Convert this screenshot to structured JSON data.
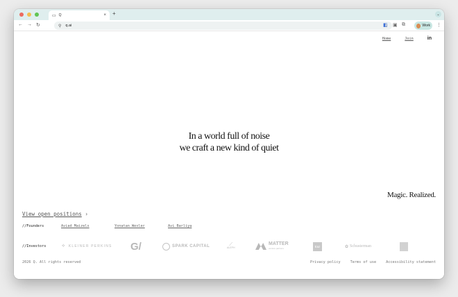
{
  "browser": {
    "tab_title": "Q",
    "url": "q.ai",
    "profile_label": "Work",
    "colors": {
      "tabbar": "#dfeeee",
      "light_red": "#ec6a5e",
      "light_yellow": "#f4bf4f",
      "light_green": "#61c554"
    }
  },
  "nav": {
    "home": "Home",
    "join": "Join",
    "linkedin": "in"
  },
  "hero": {
    "line1": "In a world full of noise",
    "line2": "we craft a new kind of quiet"
  },
  "tagline": "Magic. Realized.",
  "positions": {
    "label": "View open positions",
    "arrow": "›"
  },
  "founders": {
    "label": "//Founders",
    "names": [
      "Aviad Maizels",
      "Yonatan Wexler",
      "Avi Barliya"
    ]
  },
  "investors": {
    "label": "//Investors",
    "logos": [
      {
        "name": "KLEINER PERKINS",
        "icon": "kp-icon"
      },
      {
        "name": "G/",
        "icon": "gv-logo"
      },
      {
        "name": "SPARK CAPITAL",
        "icon": "spark-icon"
      },
      {
        "name": "ALEPH",
        "icon": "aleph-icon"
      },
      {
        "name": "MATTER",
        "sub": "venture partners",
        "icon": "matter-icon"
      },
      {
        "name": "Eaz",
        "icon": "eaz-logo"
      },
      {
        "name": "Schusterman",
        "icon": "schusterman-icon"
      },
      {
        "name": "",
        "icon": "square-logo"
      }
    ]
  },
  "footer": {
    "copyright": "2026 Q. All rights reserved",
    "privacy": "Privacy policy",
    "terms": "Terms of use",
    "accessibility": "Accessibility statement"
  }
}
